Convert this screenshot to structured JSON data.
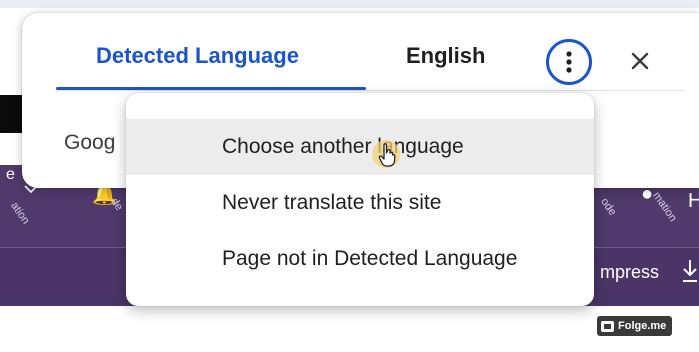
{
  "translate_bubble": {
    "tabs": [
      {
        "label": "Detected Language",
        "selected": true
      },
      {
        "label": "English",
        "selected": false
      }
    ],
    "footer_text_partial": "Goog",
    "icons": {
      "more": "more-vert-icon",
      "close": "close-icon"
    },
    "accent_color": "#1a56c7"
  },
  "options_menu": {
    "items": [
      {
        "label": "Choose another language",
        "hovered": true
      },
      {
        "label": "Never translate this site",
        "hovered": false
      },
      {
        "label": "Page not in Detected Language",
        "hovered": false
      }
    ]
  },
  "background_page": {
    "nav_color": "#4f3a6b",
    "fragment_left": "e",
    "fragment_right": "H",
    "compress_label": "mpress",
    "rotated_labels": [
      "ation",
      "de",
      "ode",
      "mation"
    ]
  },
  "watermark": {
    "label": "Folge.me"
  }
}
